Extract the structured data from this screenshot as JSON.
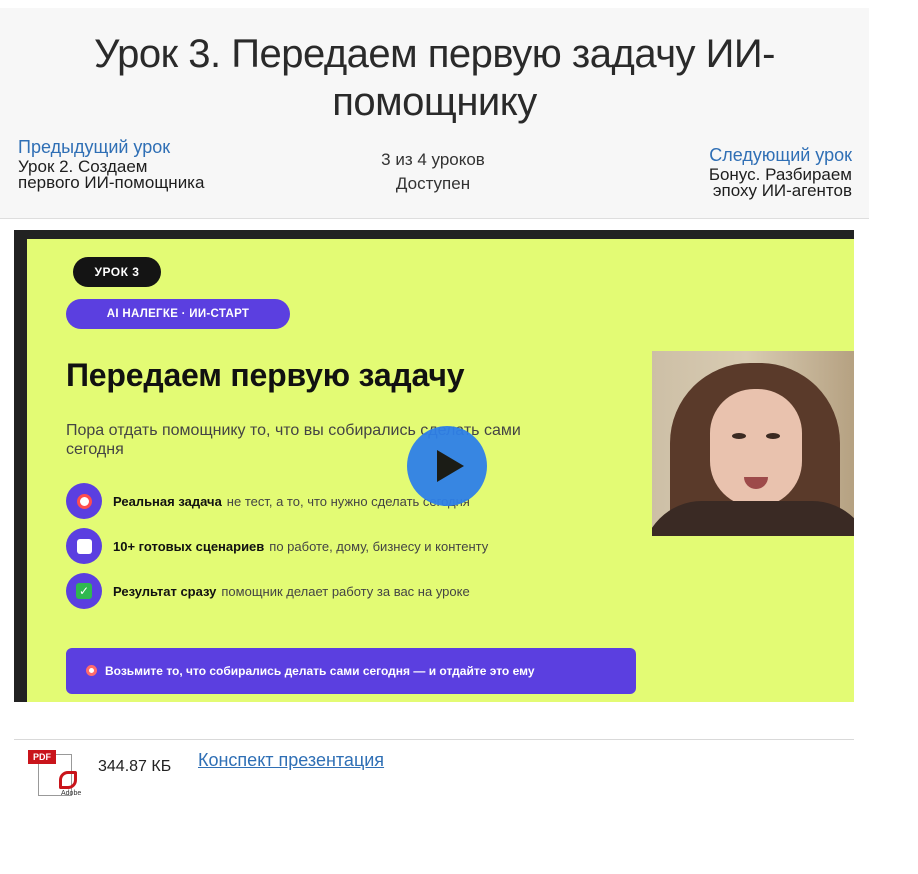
{
  "lesson": {
    "title": "Урок 3. Передаем первую задачу ИИ-помощнику"
  },
  "nav": {
    "prev_label": "Предыдущий урок",
    "prev_title": "Урок 2. Создаем первого ИИ-помощника",
    "progress": "3 из 4 уроков",
    "status": "Доступен",
    "next_label": "Следующий урок",
    "next_title": "Бонус. Разбираем эпоху ИИ-агентов"
  },
  "video": {
    "badge_lesson": "УРОК 3",
    "badge_course": "AI НАЛЕГКЕ · ИИ-СТАРТ",
    "slide_title": "Передаем первую задачу",
    "slide_subtitle": "Пора отдать помощнику то, что вы собирались сделать сами сегодня",
    "features": [
      {
        "icon": "target-icon",
        "strong": "Реальная задача",
        "text": "не тест, а то, что нужно сделать сегодня"
      },
      {
        "icon": "clipboard-icon",
        "strong": "10+ готовых сценариев",
        "text": "по работе, дому, бизнесу и контенту"
      },
      {
        "icon": "checkmark-icon",
        "strong": "Результат сразу",
        "text": "помощник делает работу за вас на уроке"
      }
    ],
    "cta": "Возьмите то, что собирались делать сами сегодня — и отдайте это ему"
  },
  "attachment": {
    "size": "344.87 КБ",
    "link": "Конспект презентация",
    "icon_label": "PDF",
    "icon_brand": "Adobe"
  },
  "colors": {
    "slide_bg": "#e3fb74",
    "accent_purple": "#5b3fe0",
    "link_blue": "#2f6fb5",
    "play_blue": "#2e80e8"
  }
}
